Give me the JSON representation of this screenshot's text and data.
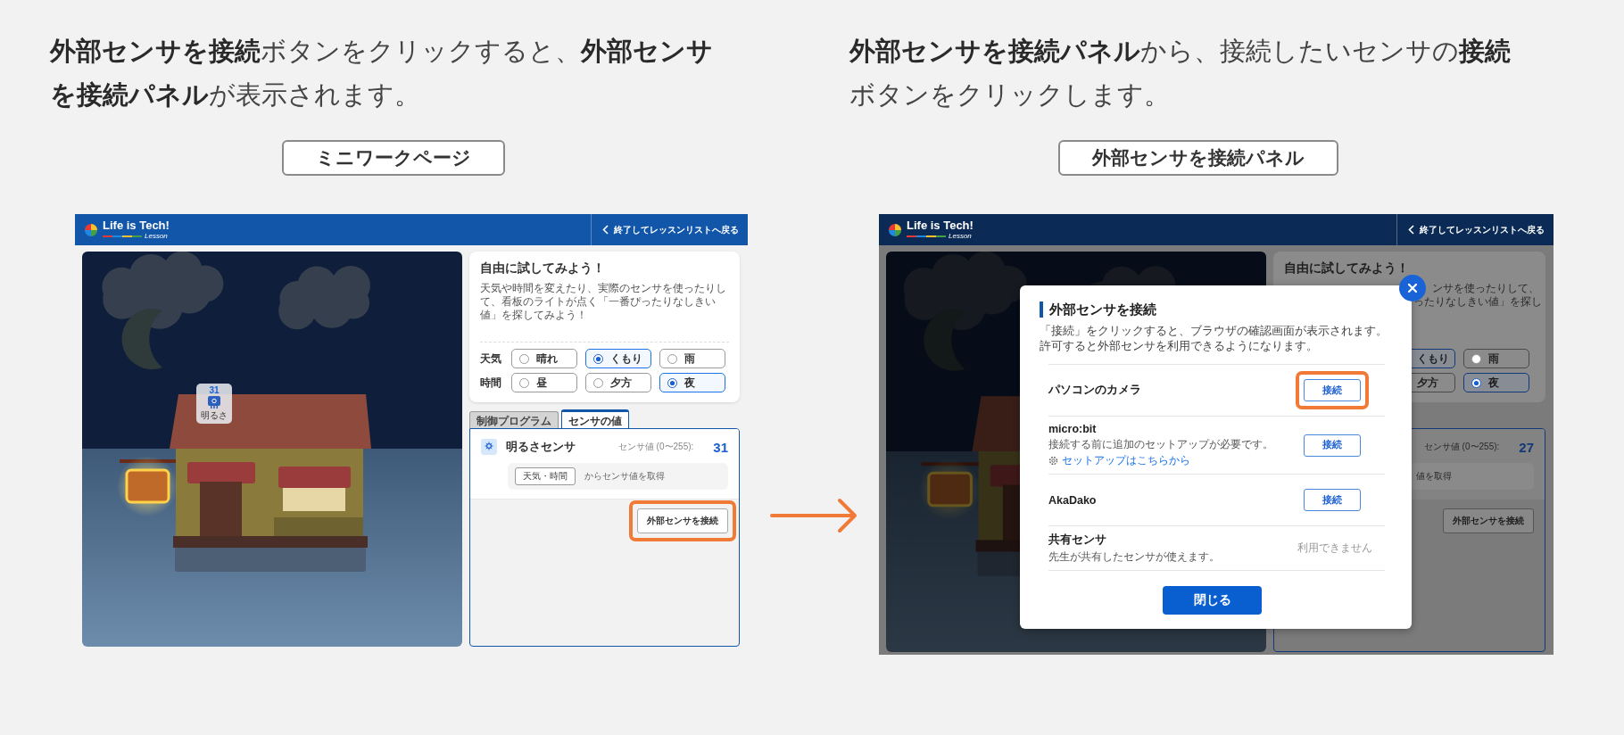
{
  "captions": [
    {
      "text": "**外部センサを接続**ボタンをクリックすると、**外部センサを接続パネル**が表示されます。"
    },
    {
      "text": "**外部センサを接続パネル**から、接続したいセンサの**接続**ボタンをクリックします。"
    }
  ],
  "screens": [
    {
      "label": "ミニワークページ",
      "dimmed": false,
      "header": {
        "logo": "Life is Tech!",
        "logo_sub": "Lesson",
        "back": "終了してレッスンリストへ戻る"
      },
      "badge": {
        "value": "31",
        "label": "明るさ"
      },
      "card": {
        "title": "自由に試してみよう！",
        "description": "天気や時間を変えたり、実際のセンサを使ったりして、看板のライトが点く「一番ぴったりなしきい値」を探してみよう！",
        "radio_groups": [
          {
            "label": "天気",
            "options": [
              {
                "label": "晴れ",
                "selected": false
              },
              {
                "label": "くもり",
                "selected": true
              },
              {
                "label": "雨",
                "selected": false
              }
            ]
          },
          {
            "label": "時間",
            "options": [
              {
                "label": "昼",
                "selected": false
              },
              {
                "label": "夕方",
                "selected": false
              },
              {
                "label": "夜",
                "selected": true
              }
            ]
          }
        ]
      },
      "tabs": [
        {
          "label": "制御プログラム",
          "selected": false
        },
        {
          "label": "センサの値",
          "selected": true
        }
      ],
      "sensor": {
        "name": "明るさセンサ",
        "value_label": "センサ値 (0〜255):",
        "value": "31",
        "source_chip": "天気・時間",
        "source_text": "からセンサ値を取得"
      },
      "connect_button": {
        "label": "外部センサを接続",
        "highlighted": true
      }
    },
    {
      "label": "外部センサを接続パネル",
      "dimmed": true,
      "header": {
        "logo": "Life is Tech!",
        "logo_sub": "Lesson",
        "back": "終了してレッスンリストへ戻る"
      },
      "card": {
        "title": "自由に試してみよう！",
        "description_fragments": [
          "ンサを使ったりして、",
          "ったりなしきい値」を探し"
        ],
        "radio_groups": [
          {
            "options": [
              {
                "label": "くもり",
                "selected": true
              },
              {
                "label": "雨",
                "selected": false
              }
            ]
          },
          {
            "options": [
              {
                "label": "夕方",
                "selected": false
              },
              {
                "label": "夜",
                "selected": true
              }
            ]
          }
        ]
      },
      "sensor": {
        "value_label": "センサ値 (0〜255):",
        "value": "27",
        "source_text": "値を取得"
      },
      "connect_button": {
        "label": "外部センサを接続",
        "highlighted": false
      },
      "modal": {
        "title": "外部センサを接続",
        "description": [
          "「接続」をクリックすると、ブラウザの確認画面が表示されます。",
          "許可すると外部センサを利用できるようになります。"
        ],
        "devices": [
          {
            "name": "パソコンのカメラ",
            "action": {
              "kind": "button",
              "label": "接続",
              "highlighted": true
            }
          },
          {
            "name": "micro:bit",
            "note": "接続する前に追加のセットアップが必要です。",
            "link": "セットアップはこちらから",
            "action": {
              "kind": "button",
              "label": "接続",
              "highlighted": false
            }
          },
          {
            "name": "AkaDako",
            "action": {
              "kind": "button",
              "label": "接続",
              "highlighted": false
            }
          },
          {
            "name": "共有センサ",
            "note": "先生が共有したセンサが使えます。",
            "action": {
              "kind": "status",
              "label": "利用できません"
            }
          }
        ],
        "close_label": "閉じる"
      }
    }
  ]
}
